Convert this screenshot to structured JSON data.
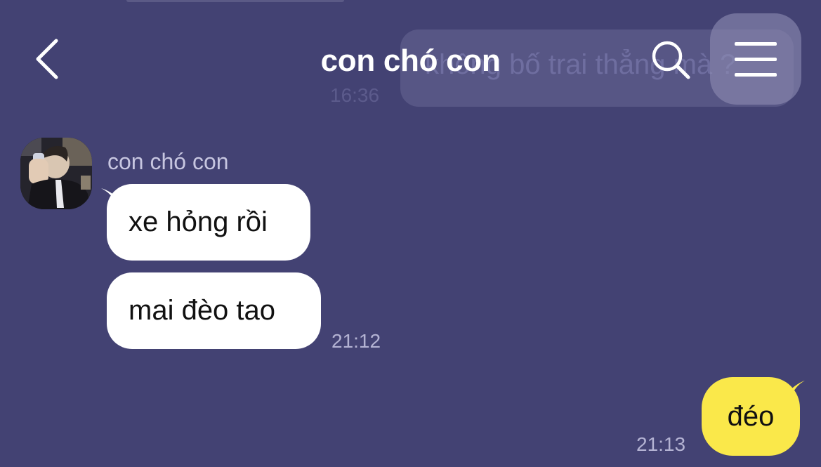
{
  "header": {
    "title": "con chó con"
  },
  "background_message": {
    "text": "không bố trai thẳng mà ?",
    "time": "16:36"
  },
  "conversation": {
    "sender_name": "con chó con",
    "incoming": [
      {
        "text": "xe hỏng rồi"
      },
      {
        "text": "mai đèo tao"
      }
    ],
    "incoming_time": "21:12",
    "outgoing": {
      "text": "đéo",
      "time": "21:13"
    }
  },
  "colors": {
    "background": "#434273",
    "incoming_bubble": "#ffffff",
    "outgoing_bubble": "#fae84a",
    "timestamp": "#b4b3d3"
  }
}
